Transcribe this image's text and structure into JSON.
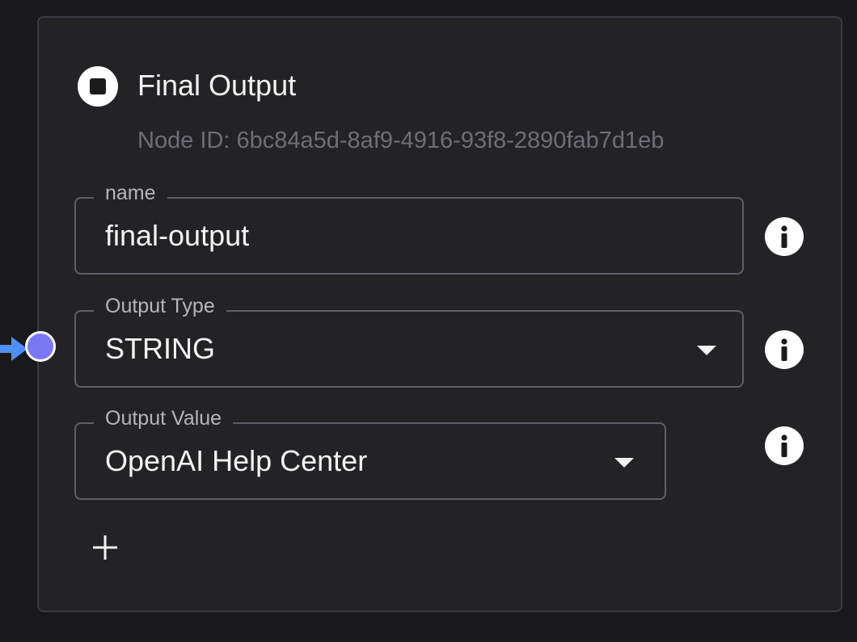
{
  "node": {
    "title": "Final Output",
    "id_label": "Node ID: 6bc84a5d-8af9-4916-93f8-2890fab7d1eb",
    "header_icon": "stop-icon"
  },
  "fields": {
    "name": {
      "label": "name",
      "value": "final-output",
      "info_icon": "info-icon"
    },
    "output_type": {
      "label": "Output Type",
      "value": "STRING",
      "info_icon": "info-icon"
    },
    "output_value": {
      "label": "Output Value",
      "value": "OpenAI Help Center",
      "info_icon": "info-icon"
    }
  },
  "add_button": {
    "icon": "plus-icon"
  },
  "colors": {
    "background": "#19191c",
    "card": "#232326",
    "card_border": "#3a3b42",
    "field_border": "#5e5f66",
    "handle": "#7b78f6",
    "connector_arrow": "#4f8ff7"
  }
}
